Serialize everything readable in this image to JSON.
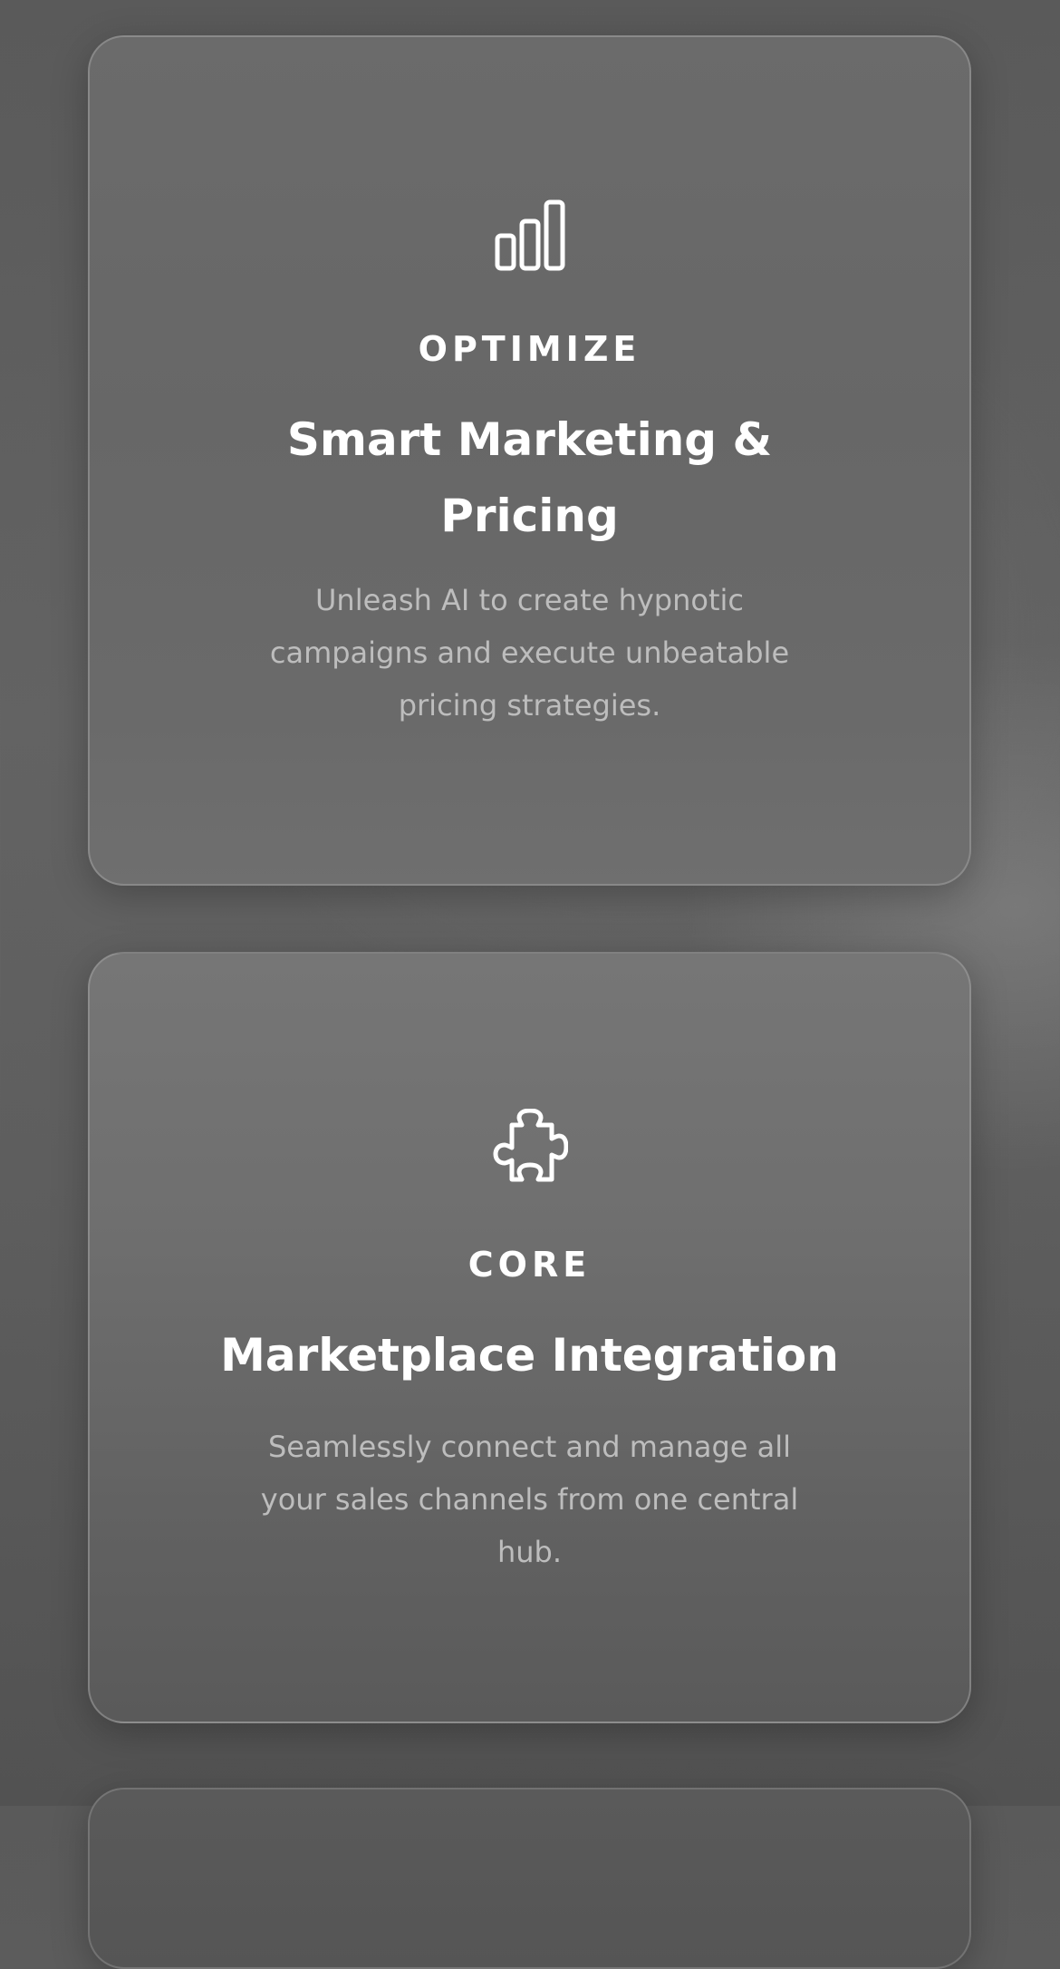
{
  "cards": [
    {
      "icon": "bar-chart-icon",
      "eyebrow": "OPTIMIZE",
      "title_lines": [
        "Smart Marketing &",
        "Pricing"
      ],
      "description_lines": [
        "Unleash AI to create hypnotic",
        "campaigns and execute unbeatable",
        "pricing strategies."
      ]
    },
    {
      "icon": "puzzle-piece-icon",
      "eyebrow": "CORE",
      "title_lines": [
        "Marketplace Integration"
      ],
      "description_lines": [
        "Seamlessly connect and manage all",
        "your sales channels from one central",
        "hub."
      ]
    }
  ],
  "colors": {
    "heading": "#ffffff",
    "description": "#bdbdbd",
    "card_border": "#a0a0a0"
  }
}
